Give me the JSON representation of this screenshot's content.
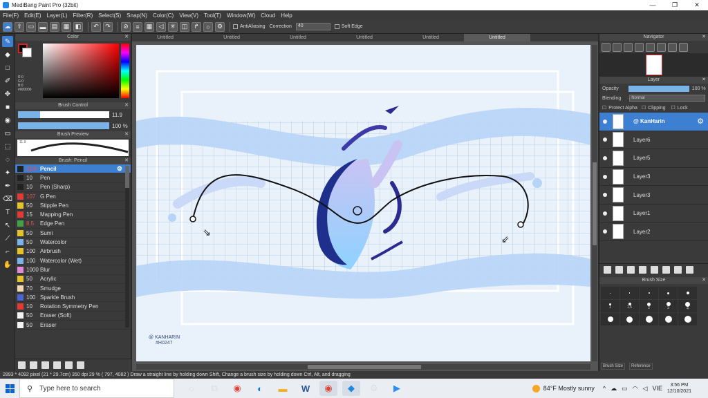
{
  "window": {
    "title": "MediBang Paint Pro (32bit)",
    "min": "—",
    "max": "❐",
    "close": "✕"
  },
  "menu": [
    "File(F)",
    "Edit(E)",
    "Layer(L)",
    "Filter(R)",
    "Select(S)",
    "Snap(N)",
    "Color(C)",
    "View(V)",
    "Tool(T)",
    "Window(W)",
    "Cloud",
    "Help"
  ],
  "toolbar": {
    "antialiasing_label": "AntiAliasing",
    "correction_label": "Correction",
    "correction_value": "40",
    "soft_edge_label": "Soft Edge"
  },
  "left": {
    "color_title": "Color",
    "color_readout": [
      "R:0",
      "G:0",
      "B:0",
      "#000000"
    ],
    "brush_control_title": "Brush Control",
    "size_value": "11.9",
    "opacity_value": "100 %",
    "opacity_fraction": 1.0,
    "size_fraction": 0.24,
    "preview_title": "Brush Preview",
    "preview_size": "11.9",
    "brush_panel_title": "Brush: Pencil",
    "brushes": [
      {
        "size": "11.9",
        "name": "Pencil",
        "color": "#222222",
        "red": true,
        "selected": true
      },
      {
        "size": "10",
        "name": "Pen",
        "color": "#222222",
        "red": false
      },
      {
        "size": "10",
        "name": "Pen (Sharp)",
        "color": "#222222",
        "red": false
      },
      {
        "size": "107",
        "name": "G Pen",
        "color": "#e53935",
        "red": true
      },
      {
        "size": "50",
        "name": "Stipple Pen",
        "color": "#e6c229",
        "red": false
      },
      {
        "size": "15",
        "name": "Mapping Pen",
        "color": "#e53935",
        "red": false
      },
      {
        "size": "8.5",
        "name": "Edge Pen",
        "color": "#43a047",
        "red": true
      },
      {
        "size": "50",
        "name": "Sumi",
        "color": "#e6c229",
        "red": false
      },
      {
        "size": "50",
        "name": "Watercolor",
        "color": "#7ab3e8",
        "red": false
      },
      {
        "size": "100",
        "name": "Airbrush",
        "color": "#e6c229",
        "red": false
      },
      {
        "size": "100",
        "name": "Watercolor (Wet)",
        "color": "#7ab3e8",
        "red": false
      },
      {
        "size": "1000",
        "name": "Blur",
        "color": "#e58ad6",
        "red": false
      },
      {
        "size": "50",
        "name": "Acrylic",
        "color": "#e6c229",
        "red": false
      },
      {
        "size": "70",
        "name": "Smudge",
        "color": "#f2d7b3",
        "red": false
      },
      {
        "size": "100",
        "name": "Sparkle Brush",
        "color": "#4a64d8",
        "red": false
      },
      {
        "size": "10",
        "name": "Rotation Symmetry Pen",
        "color": "#e53935",
        "red": false
      },
      {
        "size": "50",
        "name": "Eraser (Soft)",
        "color": "#f2f2f2",
        "red": false
      },
      {
        "size": "50",
        "name": "Eraser",
        "color": "#f2f2f2",
        "red": false
      }
    ]
  },
  "tabs": [
    "Untitled",
    "Untitled",
    "Untitled",
    "Untitled",
    "Untitled",
    "Untitled"
  ],
  "active_tab_index": 5,
  "canvas": {
    "signature": "@ KANHARIN",
    "signature2": "#H0247"
  },
  "right": {
    "navigator_title": "Navigator",
    "layer_title": "Layer",
    "opacity_label": "Opacity",
    "opacity_value": "100 %",
    "blending_label": "Blending",
    "blending_value": "Normal",
    "protect_alpha_label": "Protect Alpha",
    "clipping_label": "Clipping",
    "lock_label": "Lock",
    "layers": [
      {
        "name": "@ KanHarin",
        "selected": true
      },
      {
        "name": "Layer6",
        "selected": false
      },
      {
        "name": "Layer5",
        "selected": false
      },
      {
        "name": "Layer3",
        "selected": false
      },
      {
        "name": "Layer3",
        "selected": false
      },
      {
        "name": "Layer1",
        "selected": false
      },
      {
        "name": "Layer2",
        "selected": false
      }
    ],
    "brush_size_title": "Brush Size",
    "brush_sizes": [
      "1",
      "1.5",
      "2",
      "3",
      "4"
    ],
    "brush_size_tab": "Brush Size",
    "reference_tab": "Reference"
  },
  "status": "2893 * 4092 pixel  (21 * 29.7cm)  350 dpi  29 %  ( 797, 4082 )  Draw a straight line by holding down Shift, Change a brush size by holding down Ctrl, Alt, and dragging",
  "taskbar": {
    "search_placeholder": "Type here to search",
    "weather": "84°F  Mostly sunny",
    "lang": "VIE",
    "time": "3:56 PM",
    "date": "12/10/2021"
  }
}
